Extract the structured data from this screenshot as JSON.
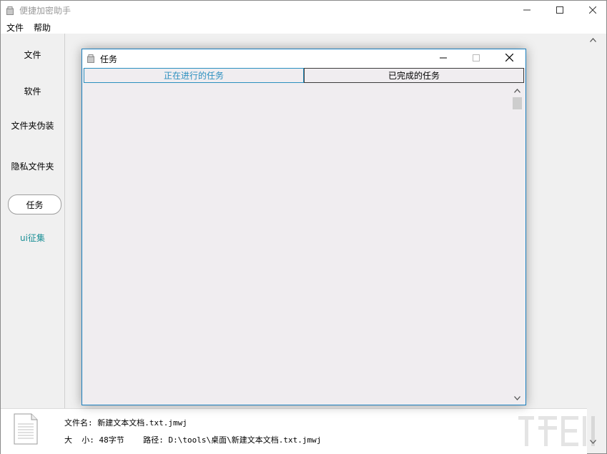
{
  "main_window": {
    "title": "便捷加密助手",
    "menu": {
      "file": "文件",
      "help": "帮助"
    }
  },
  "sidebar": {
    "items": [
      {
        "label": "文件"
      },
      {
        "label": "软件"
      },
      {
        "label": "文件夹伪装"
      },
      {
        "label": "隐私文件夹"
      },
      {
        "label": "任务",
        "selected": true
      },
      {
        "label": "ui征集"
      }
    ],
    "collect_color": "#1a8f96"
  },
  "status": {
    "file_name_label": "文件名:",
    "file_name": "新建文本文档.txt.jmwj",
    "size_label": "大  小:",
    "size": "48字节",
    "path_label": "路径:",
    "path": "D:\\tools\\桌面\\新建文本文档.txt.jmwj"
  },
  "dialog": {
    "title": "任务",
    "tabs": [
      {
        "label": "正在进行的任务",
        "active": true
      },
      {
        "label": "已完成的任务",
        "active": false
      }
    ],
    "accent_color": "#2a8fbf"
  },
  "icons": {
    "app": "app-icon",
    "minimize": "minimize-icon",
    "maximize": "maximize-icon",
    "close": "close-icon",
    "file": "file-icon",
    "scroll_up": "chevron-up-icon",
    "scroll_down": "chevron-down-icon"
  }
}
